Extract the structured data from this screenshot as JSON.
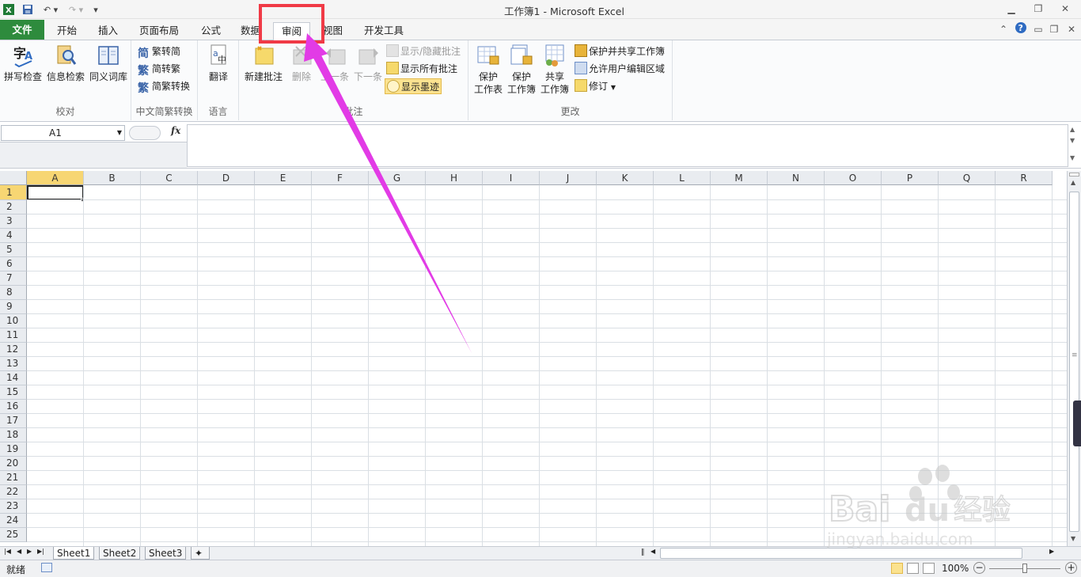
{
  "titlebar": {
    "window_title": "工作簿1 - Microsoft Excel",
    "excel_icon": "excel-logo-icon",
    "save_icon": "save-icon",
    "undo_icon": "undo-icon",
    "redo_icon": "redo-icon",
    "customize_icon": "customize-qat-icon"
  },
  "tabs": {
    "file": "文件",
    "home": "开始",
    "insert": "插入",
    "page_layout": "页面布局",
    "formulas": "公式",
    "data": "数据",
    "review": "审阅",
    "view": "视图",
    "developer": "开发工具"
  },
  "ribbon": {
    "proofing": {
      "label": "校对",
      "spelling": "拼写检查",
      "research": "信息检索",
      "thesaurus": "同义词库"
    },
    "chinese": {
      "label": "中文简繁转换",
      "to_simplified": "繁转简",
      "to_traditional": "简转繁",
      "convert": "简繁转换"
    },
    "language": {
      "label": "语言",
      "translate": "翻译"
    },
    "comments": {
      "label": "批注",
      "new": "新建批注",
      "delete": "删除",
      "previous": "上一条",
      "next": "下一条",
      "show_hide": "显示/隐藏批注",
      "show_all": "显示所有批注",
      "show_ink": "显示墨迹"
    },
    "changes": {
      "label": "更改",
      "protect_sheet_1": "保护",
      "protect_sheet_2": "工作表",
      "protect_wb_1": "保护",
      "protect_wb_2": "工作簿",
      "share_wb_1": "共享",
      "share_wb_2": "工作簿",
      "protect_share": "保护并共享工作簿",
      "allow_edit": "允许用户编辑区域",
      "track_changes": "修订"
    }
  },
  "formula_bar": {
    "name_box": "A1",
    "fx_label": "fx",
    "formula": ""
  },
  "grid": {
    "columns": [
      "A",
      "B",
      "C",
      "D",
      "E",
      "F",
      "G",
      "H",
      "I",
      "J",
      "K",
      "L",
      "M",
      "N",
      "O",
      "P",
      "Q",
      "R"
    ],
    "rows": [
      "1",
      "2",
      "3",
      "4",
      "5",
      "6",
      "7",
      "8",
      "9",
      "10",
      "11",
      "12",
      "13",
      "14",
      "15",
      "16",
      "17",
      "18",
      "19",
      "20",
      "21",
      "22",
      "23",
      "24",
      "25"
    ],
    "active_cell": "A1"
  },
  "sheets": {
    "sheet1": "Sheet1",
    "sheet2": "Sheet2",
    "sheet3": "Sheet3"
  },
  "statusbar": {
    "status": "就绪",
    "zoom": "100%"
  },
  "watermark": {
    "brand": "Baidu经验",
    "url": "jingyan.baidu.com"
  },
  "colors": {
    "file_tab": "#2e8b3d",
    "highlight_box": "#f03a46",
    "arrow": "#e23be6",
    "active_header": "#f7d673"
  }
}
